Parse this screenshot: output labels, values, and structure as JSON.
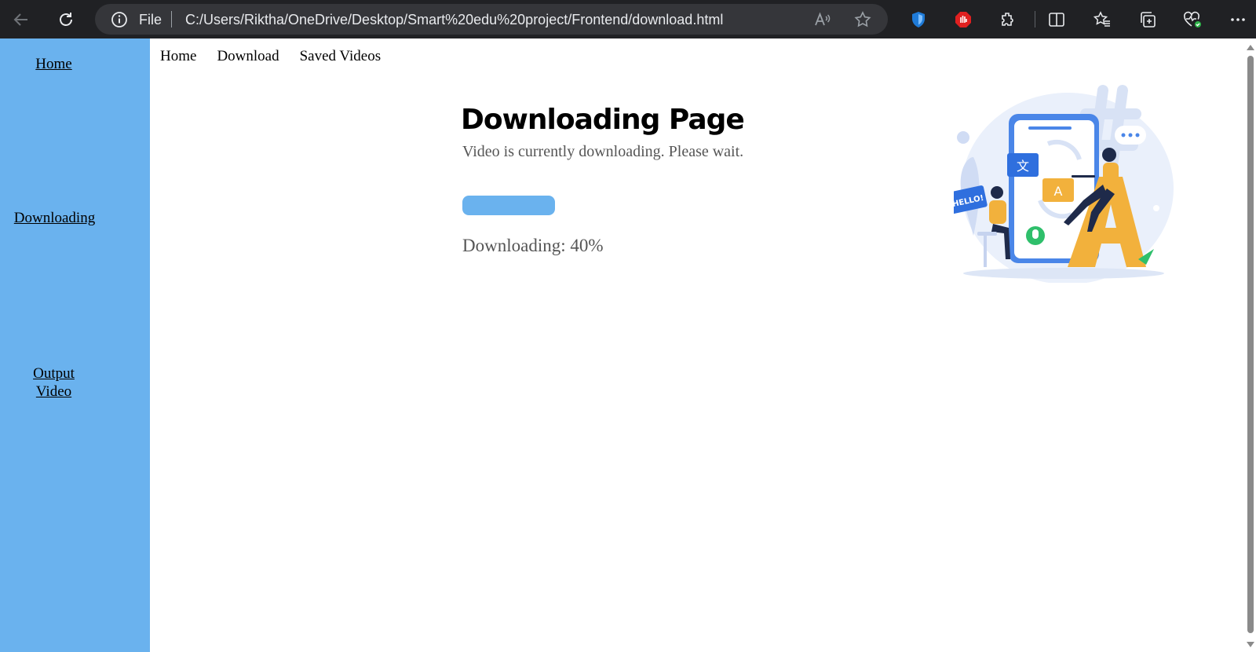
{
  "browser": {
    "file_label": "File",
    "url": "C:/Users/Riktha/OneDrive/Desktop/Smart%20edu%20project/Frontend/download.html"
  },
  "sidebar": {
    "items": [
      {
        "label": "Home"
      },
      {
        "label": "Downloading"
      },
      {
        "label_line1": "Output",
        "label_line2": "Video"
      }
    ]
  },
  "topnav": {
    "items": [
      "Home",
      "Download",
      "Saved Videos"
    ]
  },
  "main": {
    "title": "Downloading Page",
    "subtitle": "Video is currently downloading. Please wait.",
    "progress_fraction": 1.0,
    "progress_text": "Downloading: 40%"
  },
  "illustration": {
    "hello_text": "HELLO!",
    "glyph_cjk": "文",
    "glyph_latin": "A"
  },
  "colors": {
    "sidebar": "#6ab2ee",
    "progress": "#6ab2ee",
    "browser_bar": "#202124"
  },
  "icons": [
    "back-arrow-icon",
    "refresh-icon",
    "info-icon",
    "read-aloud-icon",
    "favorite-star-icon",
    "shield-icon",
    "stop-hand-icon",
    "extensions-icon",
    "split-screen-icon",
    "favorites-icon",
    "collections-icon",
    "health-icon",
    "more-icon"
  ]
}
